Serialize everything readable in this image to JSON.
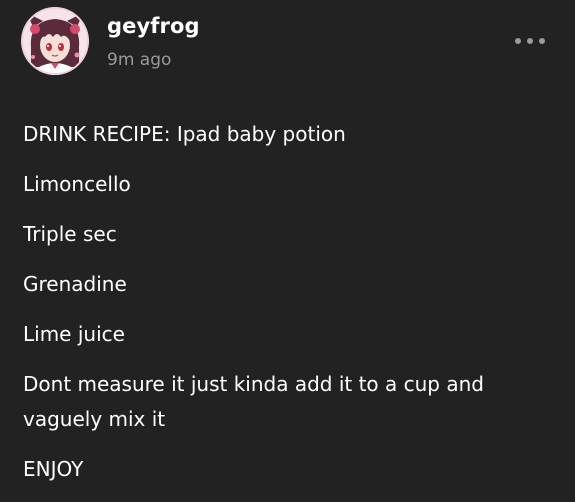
{
  "post": {
    "author": "geyfrog",
    "time": "9m ago",
    "more_icon": "more-horizontal-icon",
    "avatar_colors": {
      "ring": "#f2cfdc",
      "background": "#f7e4ea",
      "hair": "#5a2b3a",
      "skin": "#f6dfd6",
      "accent": "#d84a6a"
    },
    "lines": [
      "DRINK RECIPE: Ipad baby potion",
      "Limoncello",
      "Triple sec",
      "Grenadine",
      "Lime juice",
      "Dont measure it just kinda add it to a cup and vaguely mix it",
      "ENJOY"
    ]
  },
  "theme": {
    "background": "#222222",
    "text": "#ffffff",
    "muted": "#9a9a9a"
  }
}
